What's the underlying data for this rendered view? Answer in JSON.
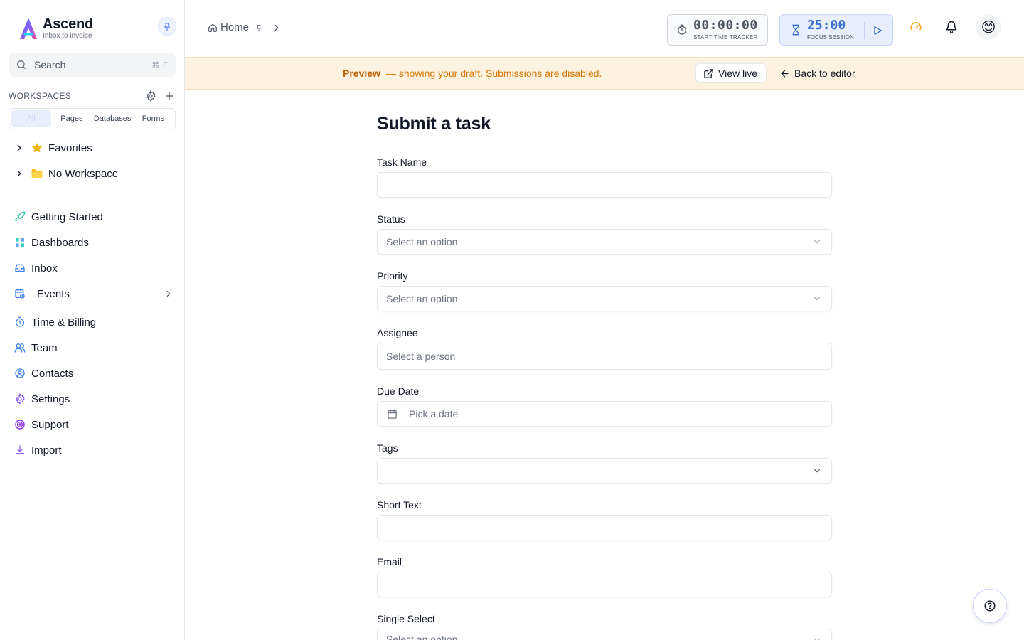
{
  "sidebar": {
    "brand": {
      "name": "Ascend",
      "tagline": "Inbox to invoice"
    },
    "search": {
      "placeholder": "Search",
      "shortcut": "⌘ F"
    },
    "workspaces": {
      "title": "WORKSPACES",
      "filters": [
        "All",
        "Pages",
        "Databases",
        "Forms"
      ],
      "active_filter": "All",
      "tree": [
        {
          "label": "Favorites",
          "icon": "star-icon"
        },
        {
          "label": "No Workspace",
          "icon": "folder-icon"
        }
      ]
    },
    "nav": [
      {
        "label": "Getting Started",
        "icon": "rocket-icon"
      },
      {
        "label": "Dashboards",
        "icon": "grid-icon"
      },
      {
        "label": "Inbox",
        "icon": "inbox-icon"
      },
      {
        "label": "Events",
        "icon": "calendar-clock-icon"
      },
      {
        "label": "Time & Billing",
        "icon": "timer-icon"
      },
      {
        "label": "Team",
        "icon": "users-icon"
      },
      {
        "label": "Contacts",
        "icon": "contact-icon"
      },
      {
        "label": "Settings",
        "icon": "gear-icon"
      },
      {
        "label": "Support",
        "icon": "lifebuoy-icon"
      },
      {
        "label": "Import",
        "icon": "download-icon"
      }
    ]
  },
  "topbar": {
    "breadcrumb": {
      "home": "Home"
    },
    "tracker": {
      "time": "00:00:00",
      "label": "START TIME TRACKER"
    },
    "focus": {
      "time": "25:00",
      "label": "FOCUS SESSION"
    },
    "avatar": "😊"
  },
  "banner": {
    "strong": "Preview",
    "message": "— showing your draft. Submissions are disabled.",
    "view_live": "View live",
    "back_to_editor": "Back to editor"
  },
  "form": {
    "title": "Submit a task",
    "fields": [
      {
        "label": "Task Name",
        "type": "text",
        "placeholder": ""
      },
      {
        "label": "Status",
        "type": "select",
        "placeholder": "Select an option"
      },
      {
        "label": "Priority",
        "type": "select",
        "placeholder": "Select an option"
      },
      {
        "label": "Assignee",
        "type": "person",
        "placeholder": "Select a person"
      },
      {
        "label": "Due Date",
        "type": "date",
        "placeholder": "Pick a date"
      },
      {
        "label": "Tags",
        "type": "multiselect",
        "placeholder": ""
      },
      {
        "label": "Short Text",
        "type": "text",
        "placeholder": ""
      },
      {
        "label": "Email",
        "type": "email",
        "placeholder": ""
      },
      {
        "label": "Single Select",
        "type": "select",
        "placeholder": "Select an option"
      }
    ]
  },
  "colors": {
    "accent": "#3b6fd4",
    "banner_bg": "#fdf1df",
    "banner_text": "#d97706",
    "star": "#f5b400",
    "folder": "#fbbf24"
  }
}
